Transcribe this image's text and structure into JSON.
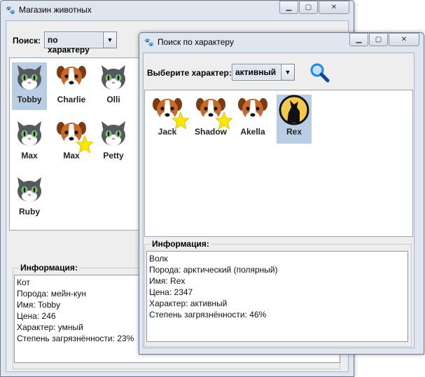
{
  "main_window": {
    "title": "Магазин животных",
    "search_label": "Поиск:",
    "search_mode": "по характеру",
    "animals": [
      {
        "name": "Tobby",
        "kind": "cat",
        "selected": true,
        "star": false
      },
      {
        "name": "Charlie",
        "kind": "dog",
        "selected": false,
        "star": false
      },
      {
        "name": "Olli",
        "kind": "cat",
        "selected": false,
        "star": false
      },
      {
        "name": "Max",
        "kind": "cat",
        "selected": false,
        "star": false
      },
      {
        "name": "Max",
        "kind": "dog",
        "selected": false,
        "star": true
      },
      {
        "name": "Petty",
        "kind": "cat",
        "selected": false,
        "star": false
      },
      {
        "name": "Ruby",
        "kind": "cat",
        "selected": false,
        "star": false
      }
    ],
    "info": {
      "title": "Информация:",
      "lines": [
        "Кот",
        "Порода: мейн-кун",
        "Имя: Tobby",
        "Цена: 246",
        "Характер: умный",
        "Степень загрязнённости: 23%"
      ]
    }
  },
  "search_window": {
    "title": "Поиск по характеру",
    "choose_label": "Выберите характер:",
    "character": "активный",
    "animals": [
      {
        "name": "Jack",
        "kind": "dog",
        "selected": false,
        "star": true
      },
      {
        "name": "Shadow",
        "kind": "dog",
        "selected": false,
        "star": true
      },
      {
        "name": "Akella",
        "kind": "dog",
        "selected": false,
        "star": false
      },
      {
        "name": "Rex",
        "kind": "wolf",
        "selected": true,
        "star": false
      }
    ],
    "info": {
      "title": "Информация:",
      "lines": [
        "Волк",
        "Порода: арктический (полярный)",
        "Имя: Rex",
        "Цена: 2347",
        "Характер: активный",
        "Степень загрязнённости: 46%"
      ]
    }
  },
  "icons": {
    "app": "paw-icon",
    "search": "magnifier-icon",
    "minimize": "minimize-icon",
    "maximize": "maximize-icon",
    "close": "close-icon",
    "dropdown": "chevron-down-icon",
    "badge": "star-icon"
  },
  "colors": {
    "selection": "#b9cde5",
    "star": "#ffe600",
    "dog_fur": "#c8692a",
    "cat_fur": "#55595e",
    "cat_eyes": "#7cc576"
  }
}
